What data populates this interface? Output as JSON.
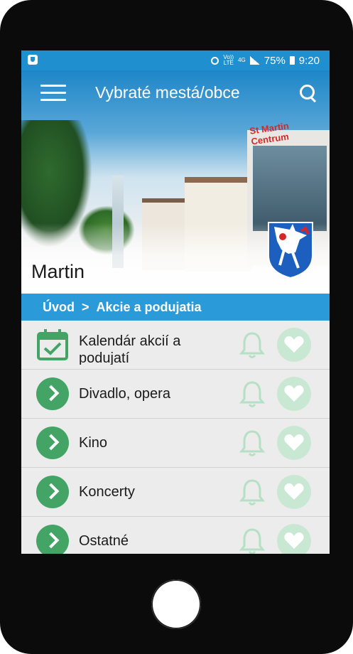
{
  "status_bar": {
    "network_label_top": "Vo))",
    "network_label_bottom": "LTE",
    "network_4g": "4G",
    "battery_percent": "75%",
    "time": "9:20"
  },
  "header": {
    "title": "Vybraté mestá/obce"
  },
  "hero": {
    "city_name": "Martin",
    "sign_text": "St Martin Centrum"
  },
  "breadcrumb": {
    "home": "Úvod",
    "separator": ">",
    "current": "Akcie a podujatia"
  },
  "list": {
    "items": [
      {
        "label": "Kalendár akcií a podujatí",
        "icon": "calendar-check-icon"
      },
      {
        "label": "Divadlo, opera",
        "icon": "chevron-right-icon"
      },
      {
        "label": "Kino",
        "icon": "chevron-right-icon"
      },
      {
        "label": "Koncerty",
        "icon": "chevron-right-icon"
      },
      {
        "label": "Ostatné",
        "icon": "chevron-right-icon"
      }
    ]
  },
  "colors": {
    "primary_blue": "#2a9ad8",
    "accent_green": "#43a466",
    "light_green": "#c9e8d4"
  }
}
